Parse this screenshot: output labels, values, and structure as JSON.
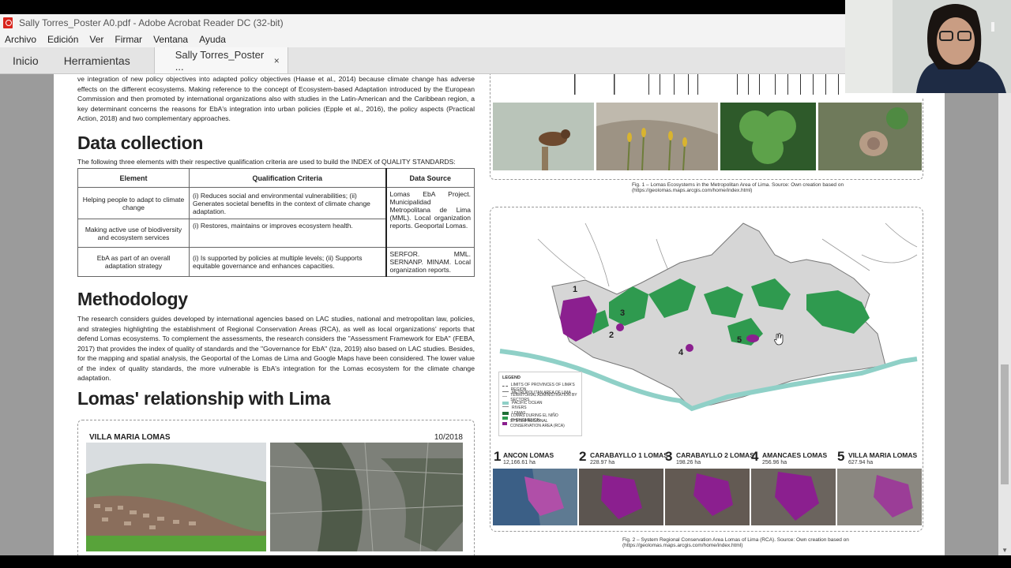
{
  "window": {
    "title": "Sally Torres_Poster A0.pdf - Adobe Acrobat Reader DC (32-bit)"
  },
  "menu": [
    "Archivo",
    "Edición",
    "Ver",
    "Firmar",
    "Ventana",
    "Ayuda"
  ],
  "tabs": {
    "home": "Inicio",
    "tools": "Herramientas",
    "document": "Sally Torres_Poster ...",
    "close_glyph": "×"
  },
  "poster": {
    "intro_text": "ve integration of new policy objectives into adapted policy objectives (Haase et al., 2014) because climate change has adverse effects on the different ecosystems.  Making reference to the concept of Ecosystem-based Adaptation introduced by the European Commission and then promoted by international organizations also with studies in the Latin-American and the Caribbean region, a key determinant concerns the reasons for EbA's integration into urban policies (Epple et al., 2016), the policy aspects (Practical Action, 2018) and two complementary approaches.",
    "data_collection": {
      "heading": "Data collection",
      "intro": "The following three elements with their respective qualification criteria are used to build the INDEX of QUALITY STANDARDS:",
      "columns": [
        "Element",
        "Qualification Criteria",
        "Data Source"
      ],
      "rows": [
        {
          "element": "Helping people to adapt to climate change",
          "criteria": "(i) Reduces social and environmental vulnerabilities; (ii) Generates societal benefits in the context of climate change adaptation."
        },
        {
          "element": "Making active use of biodiversity and ecosystem services",
          "criteria": "(i) Restores, maintains or improves ecosystem health."
        },
        {
          "element": "EbA as part of an overall adaptation strategy",
          "criteria": "(i) Is supported by policies at multiple levels; (ii) Supports equitable governance and enhances capacities."
        }
      ],
      "sources": [
        "Lomas EbA Project. Municipalidad Metropolitana de Lima (MML). Local organization reports. Geoportal Lomas.",
        "SERFOR. MML. SERNANP. MINAM. Local organization reports."
      ]
    },
    "methodology": {
      "heading": "Methodology",
      "text": "The research considers guides developed by international agencies based on LAC studies, national and metropolitan law, policies, and strategies highlighting the establishment of Regional Conservation Areas (RCA), as well as local organizations' reports that defend Lomas ecosystems. To complement the assessments, the research considers the \"Assessment Framework for EbA\" (FEBA, 2017) that provides the index of quality of standards and the \"Governance for EbA\" (Iza, 2019) also based on LAC studies. Besides, for the mapping and spatial analysis, the Geoportal of the Lomas de Lima and Google Maps have been considered. The lower value of the index of quality standards, the more vulnerable is EbA's integration for the Lomas ecosystem for the climate change adaptation."
    },
    "relationship": {
      "heading": "Lomas' relationship with Lima",
      "box_title": "VILLA MARIA LOMAS",
      "box_date": "10/2018"
    },
    "fig1_caption": "Fig. 1 – Lomas Ecosystems in the Metropolitan Area of Lima. Source: Own creation based on (https://geolomas.maps.arcgis.com/home/index.html)",
    "fig2_caption": "Fig. 2 – System Regional Conservation Area Lomas of Lima (RCA). Source: Own creation based on (https://geolomas.maps.arcgis.com/home/index.html)",
    "legend": {
      "title": "LEGEND",
      "items": [
        "LIMITS OF PROVINCES OF LIMA'S REGION",
        "METROPOLITAN AREA OF LIMA",
        "TERRITORIAL ADMINISTRATION BY SECTORS",
        "PACIFIC OCEAN",
        "RIVERS",
        "LOMAS",
        "LOMAS DURING EL NIÑO PHENOMENON",
        "SYSTEM REGIONAL CONSERVATION AREA (RCA)"
      ]
    },
    "map_labels": [
      "1",
      "2",
      "3",
      "4",
      "5"
    ],
    "rca": [
      {
        "num": "1",
        "name": "ANCON LOMAS",
        "area": "12,166.61 ha"
      },
      {
        "num": "2",
        "name": "CARABAYLLO 1 LOMAS",
        "area": "228.97 ha"
      },
      {
        "num": "3",
        "name": "CARABAYLLO 2 LOMAS",
        "area": "198.26 ha"
      },
      {
        "num": "4",
        "name": "AMANCAES LOMAS",
        "area": "256.96 ha"
      },
      {
        "num": "5",
        "name": "VILLA MARIA LOMAS",
        "area": "627.94 ha"
      }
    ]
  },
  "colors": {
    "lomas_green": "#2f9a4f",
    "rca_purple": "#8b1f8f",
    "ocean": "#8fd0c7",
    "metro_gray": "#d6d6d6"
  },
  "icons": [
    "pdf-icon",
    "close-icon",
    "scroll-up-arrow-icon",
    "scroll-down-arrow-icon",
    "hand-cursor-icon"
  ]
}
